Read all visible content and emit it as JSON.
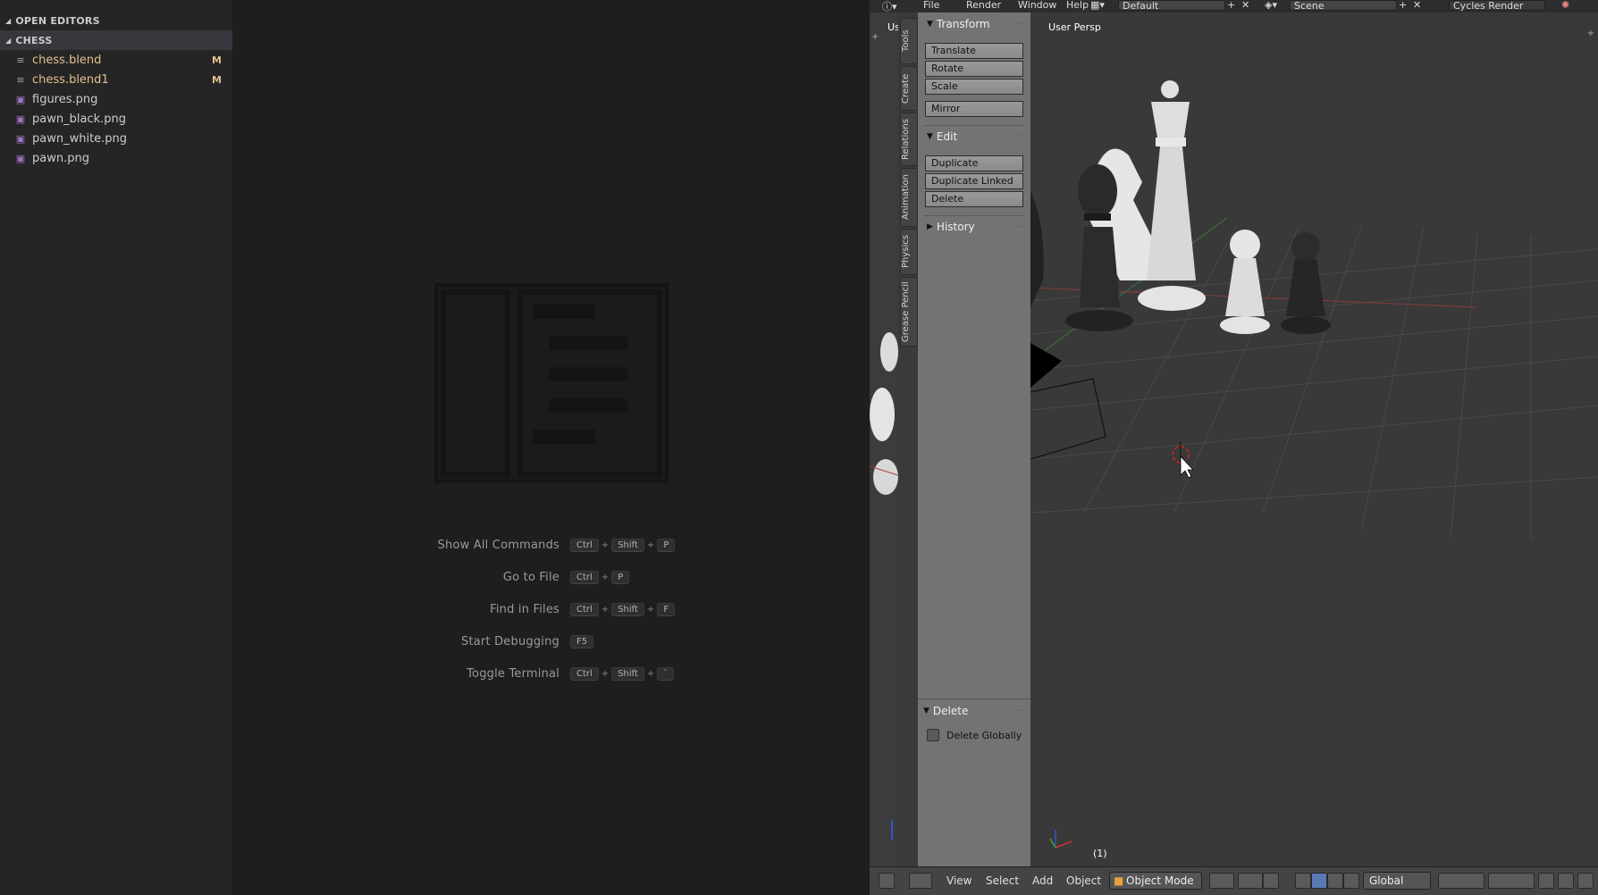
{
  "explorer": {
    "open_editors_label": "OPEN EDITORS",
    "folder_label": "CHESS",
    "files": [
      {
        "name": "chess.blend",
        "badge": "M"
      },
      {
        "name": "chess.blend1",
        "badge": "M"
      },
      {
        "name": "figures.png"
      },
      {
        "name": "pawn_black.png"
      },
      {
        "name": "pawn_white.png"
      },
      {
        "name": "pawn.png"
      }
    ]
  },
  "shortcuts": [
    {
      "label": "Show All Commands",
      "keys": [
        "Ctrl",
        "Shift",
        "P"
      ]
    },
    {
      "label": "Go to File",
      "keys": [
        "Ctrl",
        "P"
      ]
    },
    {
      "label": "Find in Files",
      "keys": [
        "Ctrl",
        "Shift",
        "F"
      ]
    },
    {
      "label": "Start Debugging",
      "keys": [
        "F5"
      ]
    },
    {
      "label": "Toggle Terminal",
      "keys": [
        "Ctrl",
        "Shift",
        "`"
      ]
    }
  ],
  "blender": {
    "menu": {
      "file": "File",
      "render": "Render",
      "window": "Window",
      "help": "Help"
    },
    "layout_name": "Default",
    "scene_name": "Scene",
    "render_engine": "Cycles Render",
    "left_view_label": "Us",
    "tabs": [
      "Tools",
      "Create",
      "Relations",
      "Animation",
      "Physics",
      "Grease Pencil"
    ],
    "transform": {
      "title": "Transform",
      "translate": "Translate",
      "rotate": "Rotate",
      "scale": "Scale",
      "mirror": "Mirror"
    },
    "edit": {
      "title": "Edit",
      "duplicate": "Duplicate",
      "duplicate_linked": "Duplicate Linked",
      "delete": "Delete"
    },
    "history": {
      "title": "History"
    },
    "redo": {
      "title": "Delete",
      "delete_globally": "Delete Globally"
    },
    "viewport": {
      "view_name": "User Persp",
      "frame": "(1)"
    },
    "bottom": {
      "view": "View",
      "select": "Select",
      "add": "Add",
      "object": "Object",
      "mode": "Object Mode",
      "orientation": "Global"
    }
  }
}
